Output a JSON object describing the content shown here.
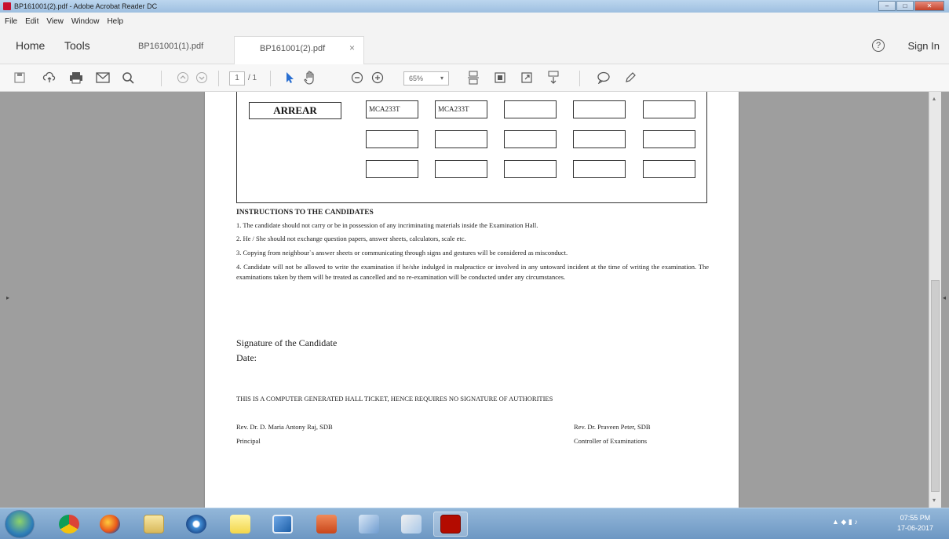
{
  "window": {
    "title": "BP161001(2).pdf - Adobe Acrobat Reader DC"
  },
  "menu": [
    "File",
    "Edit",
    "View",
    "Window",
    "Help"
  ],
  "tabs": {
    "home": "Home",
    "tools": "Tools",
    "doc1": "BP161001(1).pdf",
    "doc2": "BP161001(2).pdf",
    "close_symbol": "×"
  },
  "header": {
    "help_symbol": "?",
    "sign_in": "Sign In"
  },
  "toolbar": {
    "page_current": "1",
    "page_total": "/ 1",
    "zoom": "65%",
    "zoom_caret": "▾",
    "icons": [
      "save-icon",
      "upload-icon",
      "print-icon",
      "email-icon",
      "search-icon",
      "page-up-icon",
      "page-down-icon",
      "select-cursor-icon",
      "hand-tool-icon",
      "zoom-out-icon",
      "zoom-in-icon",
      "fit-page-icon",
      "scrolling-mode-icon",
      "full-screen-icon",
      "read-mode-icon",
      "comment-icon",
      "sign-pen-icon"
    ]
  },
  "document": {
    "arrear_label": "ARREAR",
    "arrear_codes": [
      "MCA233T",
      "MCA233T"
    ],
    "instructions_title": "INSTRUCTIONS TO THE CANDIDATES",
    "instructions": [
      "1. The candidate should not carry or be in possession of any incriminating materials inside the Examination Hall.",
      "2. He / She should not exchange question papers, answer sheets, calculators, scale etc.",
      "3. Copying from neighbour`s answer sheets or communicating through signs and gestures will be considered as misconduct.",
      "4. Candidate will not be allowed to write the examination if he/she indulged in malpractice or involved in any untoward incident at the time of writing the examination. The examinations taken by them will be treated as cancelled and no re-examination will be conducted under any circumstances."
    ],
    "signature_label": "Signature of the Candidate",
    "date_label": "Date:",
    "computer_generated_note": "THIS IS A COMPUTER GENERATED HALL TICKET, HENCE REQUIRES NO SIGNATURE OF AUTHORITIES",
    "principal_name": "Rev. Dr. D. Maria Antony Raj, SDB",
    "principal_title": "Principal",
    "controller_name": "Rev. Dr. Praveen Peter, SDB",
    "controller_title": "Controller of Examinations"
  },
  "taskbar": {
    "apps": [
      "start-orb",
      "chrome",
      "firefox",
      "file-explorer",
      "media-player",
      "sticky-notes",
      "virtualbox",
      "powerpoint",
      "network-app",
      "paint-app",
      "acrobat-reader"
    ],
    "clock_time": "07:55 PM",
    "clock_date": "17-06-2017"
  }
}
